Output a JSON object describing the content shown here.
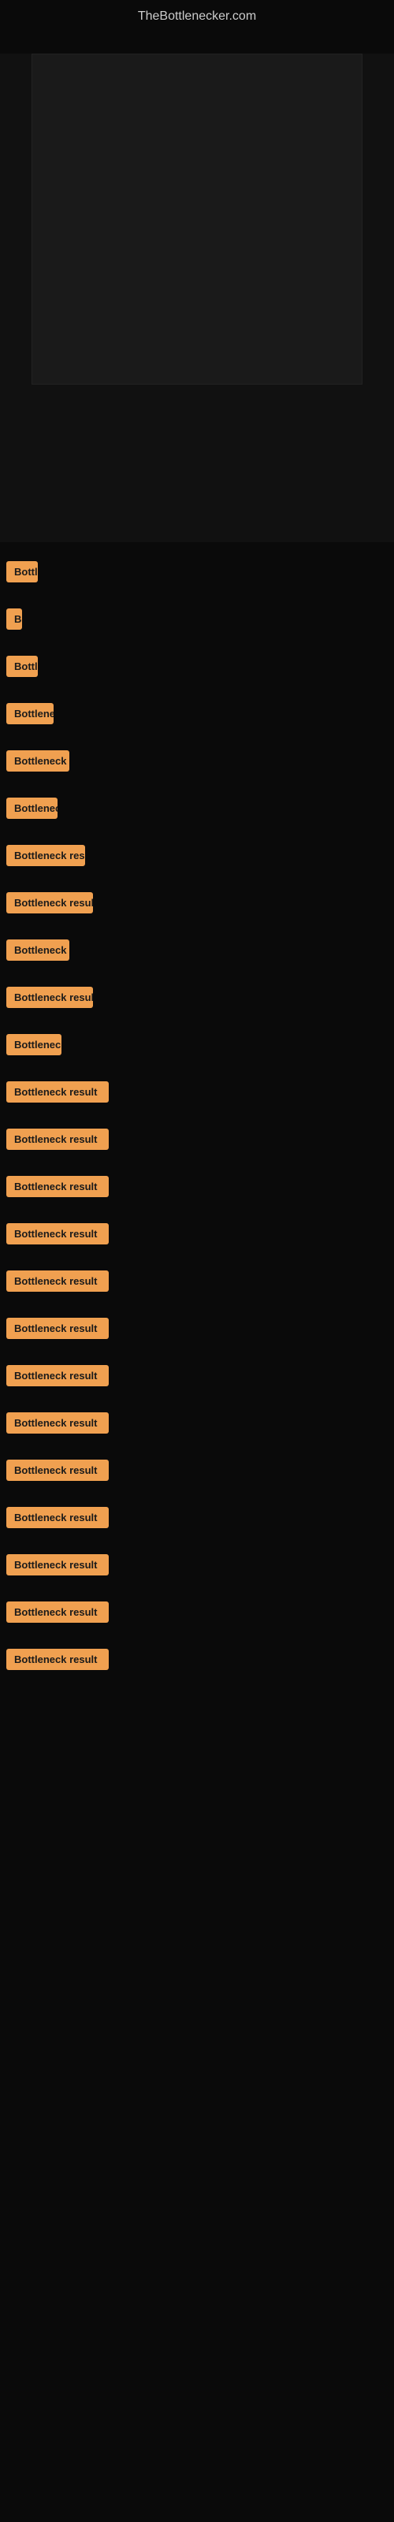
{
  "site": {
    "title": "TheBottlenecker.com"
  },
  "results": [
    {
      "label": "Bottleneck result",
      "width": 40,
      "id": 1
    },
    {
      "label": "Bottleneck result",
      "width": 10,
      "id": 2
    },
    {
      "label": "Bottleneck result",
      "width": 40,
      "id": 3
    },
    {
      "label": "Bottleneck result",
      "width": 60,
      "id": 4
    },
    {
      "label": "Bottleneck result",
      "width": 80,
      "id": 5
    },
    {
      "label": "Bottleneck result",
      "width": 65,
      "id": 6
    },
    {
      "label": "Bottleneck result",
      "width": 100,
      "id": 7
    },
    {
      "label": "Bottleneck result",
      "width": 110,
      "id": 8
    },
    {
      "label": "Bottleneck result",
      "width": 80,
      "id": 9
    },
    {
      "label": "Bottleneck result",
      "width": 110,
      "id": 10
    },
    {
      "label": "Bottleneck result",
      "width": 70,
      "id": 11
    },
    {
      "label": "Bottleneck result",
      "width": 130,
      "id": 12
    },
    {
      "label": "Bottleneck result",
      "width": 130,
      "id": 13
    },
    {
      "label": "Bottleneck result",
      "width": 130,
      "id": 14
    },
    {
      "label": "Bottleneck result",
      "width": 130,
      "id": 15
    },
    {
      "label": "Bottleneck result",
      "width": 130,
      "id": 16
    },
    {
      "label": "Bottleneck result",
      "width": 130,
      "id": 17
    },
    {
      "label": "Bottleneck result",
      "width": 130,
      "id": 18
    },
    {
      "label": "Bottleneck result",
      "width": 130,
      "id": 19
    },
    {
      "label": "Bottleneck result",
      "width": 130,
      "id": 20
    },
    {
      "label": "Bottleneck result",
      "width": 130,
      "id": 21
    },
    {
      "label": "Bottleneck result",
      "width": 130,
      "id": 22
    },
    {
      "label": "Bottleneck result",
      "width": 130,
      "id": 23
    },
    {
      "label": "Bottleneck result",
      "width": 130,
      "id": 24
    }
  ]
}
